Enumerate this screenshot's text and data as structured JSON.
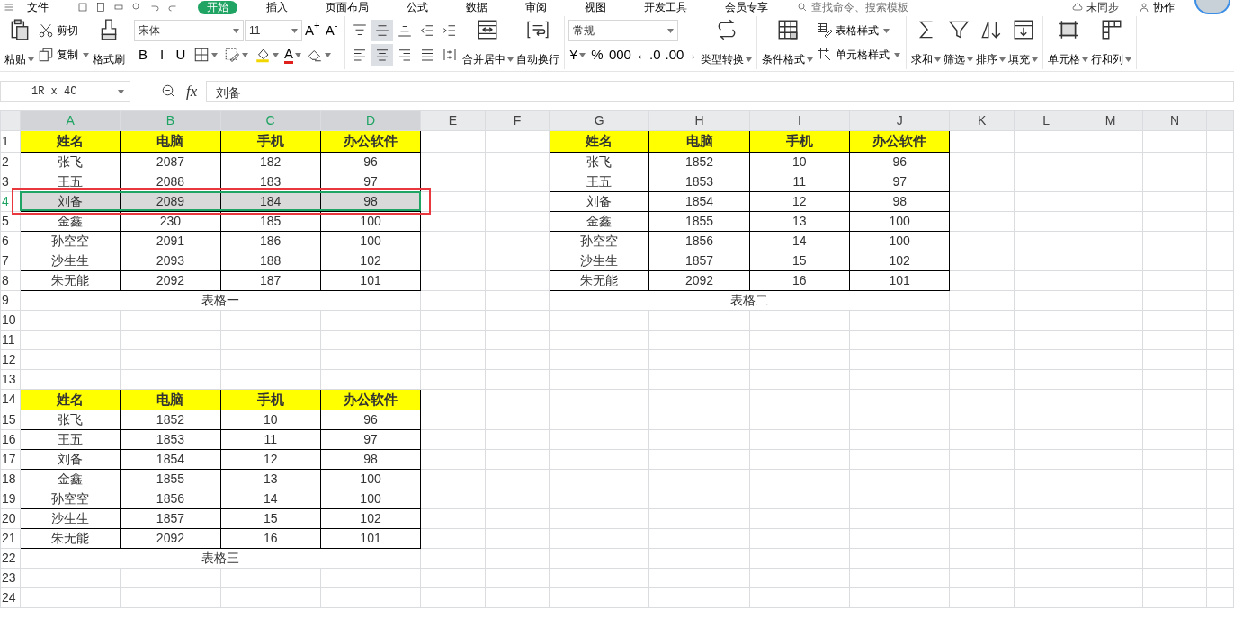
{
  "menu_bar": {
    "file_menu": "文件",
    "tabs": [
      {
        "label": "开始",
        "selected": true
      },
      {
        "label": "插入",
        "selected": false
      },
      {
        "label": "页面布局",
        "selected": false
      },
      {
        "label": "公式",
        "selected": false
      },
      {
        "label": "数据",
        "selected": false
      },
      {
        "label": "审阅",
        "selected": false
      },
      {
        "label": "视图",
        "selected": false
      },
      {
        "label": "开发工具",
        "selected": false
      },
      {
        "label": "会员专享",
        "selected": false
      }
    ],
    "search": {
      "placeholder": "查找命令、搜索模板"
    },
    "sync_status": "未同步",
    "collaborate": "协作"
  },
  "ribbon": [
    {
      "items": [
        {
          "kind": "big",
          "label": "粘贴",
          "dropdown": true
        },
        {
          "kind": "stack",
          "rows": [
            [
              {
                "kind": "tool",
                "label": "剪切",
                "dropdown": false
              }
            ],
            [
              {
                "kind": "tool",
                "label": "复制",
                "dropdown": true
              }
            ]
          ]
        },
        {
          "kind": "big",
          "label": "格式刷",
          "dropdown": false
        }
      ]
    },
    {
      "items": [
        {
          "kind": "stack",
          "rows": [
            [
              {
                "kind": "select",
                "value": "宋体"
              },
              {
                "kind": "select",
                "value": "11"
              },
              {
                "kind": "glyph",
                "label": "A$^{+}$",
                "dropdown": false
              },
              {
                "kind": "glyph",
                "label": "A$^{-}$",
                "dropdown": false
              }
            ],
            [
              {
                "kind": "glyph",
                "label": "B",
                "dropdown": false
              },
              {
                "kind": "glyph",
                "label": "I",
                "dropdown": false
              },
              {
                "kind": "glyph",
                "label": "U",
                "dropdown": false
              },
              {
                "kind": "iconbtn",
                "dropdown": true,
                "selected": false
              },
              {
                "kind": "iconbtn",
                "dropdown": true,
                "selected": false
              },
              {
                "kind": "iconbtn",
                "dropdown": true,
                "selected": false
              },
              {
                "kind": "fontcolor",
                "label": "A",
                "dropdown": true
              },
              {
                "kind": "iconbtn",
                "dropdown": true,
                "selected": false
              }
            ]
          ]
        }
      ]
    },
    {
      "items": [
        {
          "kind": "stack",
          "rows": [
            [
              {
                "kind": "iconbtn",
                "dropdown": false,
                "selected": false
              },
              {
                "kind": "iconbtn",
                "dropdown": false,
                "selected": true
              },
              {
                "kind": "iconbtn",
                "dropdown": false,
                "selected": false
              },
              {
                "kind": "iconbtn",
                "dropdown": false,
                "selected": false
              },
              {
                "kind": "iconbtn",
                "dropdown": false,
                "selected": false
              }
            ],
            [
              {
                "kind": "iconbtn",
                "dropdown": false,
                "selected": false
              },
              {
                "kind": "iconbtn",
                "dropdown": false,
                "selected": true
              },
              {
                "kind": "iconbtn",
                "dropdown": false,
                "selected": false
              },
              {
                "kind": "iconbtn",
                "dropdown": false,
                "selected": false
              },
              {
                "kind": "iconbtn",
                "dropdown": false,
                "selected": false
              }
            ]
          ]
        },
        {
          "kind": "big",
          "label": "合并居中",
          "dropdown": true
        },
        {
          "kind": "big",
          "label": "自动换行",
          "dropdown": false
        }
      ]
    },
    {
      "items": [
        {
          "kind": "stack",
          "rows": [
            [
              {
                "kind": "select",
                "value": "常规"
              }
            ],
            [
              {
                "kind": "glyph",
                "label": "¥",
                "dropdown": true
              },
              {
                "kind": "glyph",
                "label": "%",
                "dropdown": false
              },
              {
                "kind": "glyph",
                "label": "000",
                "dropdown": false
              },
              {
                "kind": "glyph",
                "label": "←.0",
                "dropdown": false
              },
              {
                "kind": "glyph",
                "label": ".00→",
                "dropdown": false
              }
            ]
          ]
        },
        {
          "kind": "big",
          "label": "类型转换",
          "dropdown": true
        }
      ]
    },
    {
      "items": [
        {
          "kind": "big",
          "label": "条件格式",
          "dropdown": true
        },
        {
          "kind": "stack",
          "rows": [
            [
              {
                "kind": "tool",
                "label": "表格样式",
                "dropdown": true
              }
            ],
            [
              {
                "kind": "tool",
                "label": "单元格样式",
                "dropdown": true
              }
            ]
          ]
        }
      ]
    },
    {
      "items": [
        {
          "kind": "big",
          "label": "求和",
          "dropdown": true
        },
        {
          "kind": "big",
          "label": "筛选",
          "dropdown": true
        },
        {
          "kind": "big",
          "label": "排序",
          "dropdown": true
        },
        {
          "kind": "big",
          "label": "填充",
          "dropdown": true
        }
      ]
    },
    {
      "items": [
        {
          "kind": "big",
          "label": "单元格",
          "dropdown": true
        },
        {
          "kind": "big",
          "label": "行和列",
          "dropdown": true
        }
      ]
    }
  ],
  "formula_bar": {
    "name_box": "1R x 4C",
    "fx": "fx",
    "value": "刘备"
  },
  "sheet": {
    "columns": [
      {
        "label": "A",
        "selected": true
      },
      {
        "label": "B",
        "selected": true
      },
      {
        "label": "C",
        "selected": true
      },
      {
        "label": "D",
        "selected": true
      },
      {
        "label": "E",
        "selected": false
      },
      {
        "label": "F",
        "selected": false
      },
      {
        "label": "G",
        "selected": false
      },
      {
        "label": "H",
        "selected": false
      },
      {
        "label": "I",
        "selected": false
      },
      {
        "label": "J",
        "selected": false
      },
      {
        "label": "K",
        "selected": false
      },
      {
        "label": "L",
        "selected": false
      },
      {
        "label": "M",
        "selected": false
      },
      {
        "label": "N",
        "selected": false
      }
    ],
    "rows": [
      {
        "label": "1",
        "selected": false
      },
      {
        "label": "2",
        "selected": false
      },
      {
        "label": "3",
        "selected": false
      },
      {
        "label": "4",
        "selected": true
      },
      {
        "label": "5",
        "selected": false
      },
      {
        "label": "6",
        "selected": false
      },
      {
        "label": "7",
        "selected": false
      },
      {
        "label": "8",
        "selected": false
      },
      {
        "label": "9",
        "selected": false
      },
      {
        "label": "10",
        "selected": false
      },
      {
        "label": "11",
        "selected": false
      },
      {
        "label": "12",
        "selected": false
      },
      {
        "label": "13",
        "selected": false
      },
      {
        "label": "14",
        "selected": false
      },
      {
        "label": "15",
        "selected": false
      },
      {
        "label": "16",
        "selected": false
      },
      {
        "label": "17",
        "selected": false
      },
      {
        "label": "18",
        "selected": false
      },
      {
        "label": "19",
        "selected": false
      },
      {
        "label": "20",
        "selected": false
      },
      {
        "label": "21",
        "selected": false
      },
      {
        "label": "22",
        "selected": false
      },
      {
        "label": "23",
        "selected": false
      },
      {
        "label": "24",
        "selected": false
      }
    ],
    "tables": [
      {
        "header": [
          "姓名",
          "电脑",
          "手机",
          "办公软件"
        ],
        "rows": [
          {
            "cells": [
              "张飞",
              "2087",
              "182",
              "96"
            ],
            "selected": false,
            "annotated": false
          },
          {
            "cells": [
              "王五",
              "2088",
              "183",
              "97"
            ],
            "selected": false,
            "annotated": false
          },
          {
            "cells": [
              "刘备",
              "2089",
              "184",
              "98"
            ],
            "selected": true,
            "annotated": true
          },
          {
            "cells": [
              "金鑫",
              "230",
              "185",
              "100"
            ],
            "selected": false,
            "annotated": false
          },
          {
            "cells": [
              "孙空空",
              "2091",
              "186",
              "100"
            ],
            "selected": false,
            "annotated": false
          },
          {
            "cells": [
              "沙生生",
              "2093",
              "188",
              "102"
            ],
            "selected": false,
            "annotated": false
          },
          {
            "cells": [
              "朱无能",
              "2092",
              "187",
              "101"
            ],
            "selected": false,
            "annotated": false
          }
        ],
        "caption": "表格一"
      },
      {
        "header": [
          "姓名",
          "电脑",
          "手机",
          "办公软件"
        ],
        "rows": [
          {
            "cells": [
              "张飞",
              "1852",
              "10",
              "96"
            ],
            "selected": false,
            "annotated": false
          },
          {
            "cells": [
              "王五",
              "1853",
              "11",
              "97"
            ],
            "selected": false,
            "annotated": false
          },
          {
            "cells": [
              "刘备",
              "1854",
              "12",
              "98"
            ],
            "selected": false,
            "annotated": false
          },
          {
            "cells": [
              "金鑫",
              "1855",
              "13",
              "100"
            ],
            "selected": false,
            "annotated": false
          },
          {
            "cells": [
              "孙空空",
              "1856",
              "14",
              "100"
            ],
            "selected": false,
            "annotated": false
          },
          {
            "cells": [
              "沙生生",
              "1857",
              "15",
              "102"
            ],
            "selected": false,
            "annotated": false
          },
          {
            "cells": [
              "朱无能",
              "2092",
              "16",
              "101"
            ],
            "selected": false,
            "annotated": false
          }
        ],
        "caption": "表格二"
      },
      {
        "header": [
          "姓名",
          "电脑",
          "手机",
          "办公软件"
        ],
        "rows": [
          {
            "cells": [
              "张飞",
              "1852",
              "10",
              "96"
            ],
            "selected": false,
            "annotated": false
          },
          {
            "cells": [
              "王五",
              "1853",
              "11",
              "97"
            ],
            "selected": false,
            "annotated": false
          },
          {
            "cells": [
              "刘备",
              "1854",
              "12",
              "98"
            ],
            "selected": false,
            "annotated": false
          },
          {
            "cells": [
              "金鑫",
              "1855",
              "13",
              "100"
            ],
            "selected": false,
            "annotated": false
          },
          {
            "cells": [
              "孙空空",
              "1856",
              "14",
              "100"
            ],
            "selected": false,
            "annotated": false
          },
          {
            "cells": [
              "沙生生",
              "1857",
              "15",
              "102"
            ],
            "selected": false,
            "annotated": false
          },
          {
            "cells": [
              "朱无能",
              "2092",
              "16",
              "101"
            ],
            "selected": false,
            "annotated": false
          }
        ],
        "caption": "表格三"
      }
    ]
  }
}
